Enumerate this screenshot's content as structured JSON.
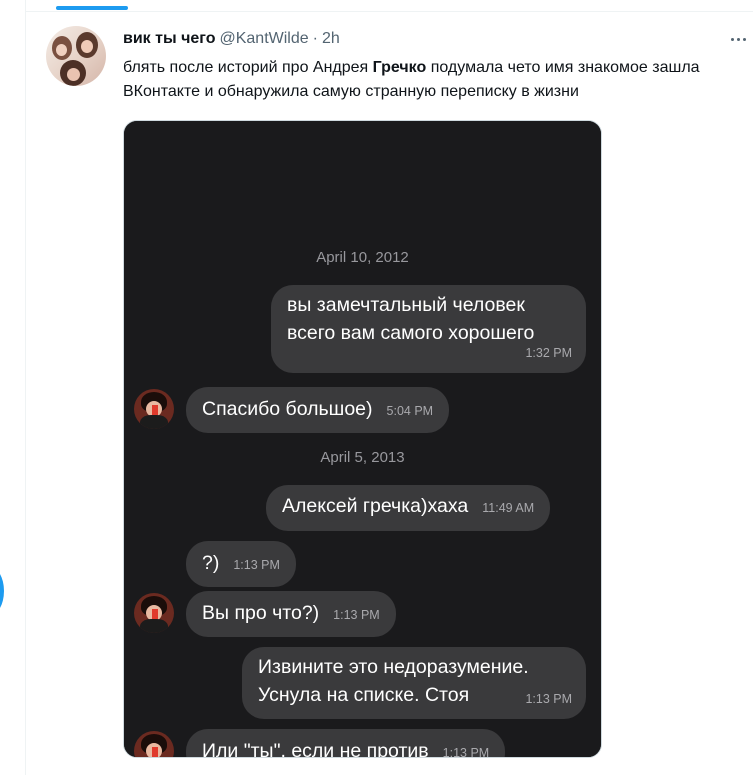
{
  "tweet": {
    "author_name": "вик ты чего",
    "handle": "@KantWilde",
    "separator": "·",
    "time": "2h",
    "text_before": "блять после историй про Андрея ",
    "text_bold": "Гречко",
    "text_after": " подумала чето имя знакомое зашла ВКонтакте и обнаружила самую странную переписку в жизни"
  },
  "conversation": {
    "dates": [
      "April 10, 2012",
      "April 5, 2013"
    ],
    "messages": [
      {
        "side": "out",
        "lines": [
          "вы замечтальный человек",
          "всего вам самого хорошего"
        ],
        "time": "1:32 PM"
      },
      {
        "side": "in",
        "lines": [
          "Спасибо большое)"
        ],
        "time": "5:04 PM"
      },
      {
        "side": "out",
        "lines": [
          "Алексей гречка)хаха"
        ],
        "time": "11:49 AM"
      },
      {
        "side": "in",
        "lines": [
          "?)"
        ],
        "time": "1:13 PM"
      },
      {
        "side": "in",
        "lines": [
          "Вы про что?)"
        ],
        "time": "1:13 PM"
      },
      {
        "side": "out",
        "lines": [
          "Извините это недоразумение.",
          "Уснула на списке. Стоя"
        ],
        "time": "1:13 PM"
      },
      {
        "side": "in",
        "lines": [
          "Или \"ты\", если не против"
        ],
        "time": "1:13 PM"
      }
    ]
  },
  "colors": {
    "accent": "#1d9bf0",
    "phone_bg": "#1a1a1c",
    "bubble_bg": "#3a3a3c"
  }
}
